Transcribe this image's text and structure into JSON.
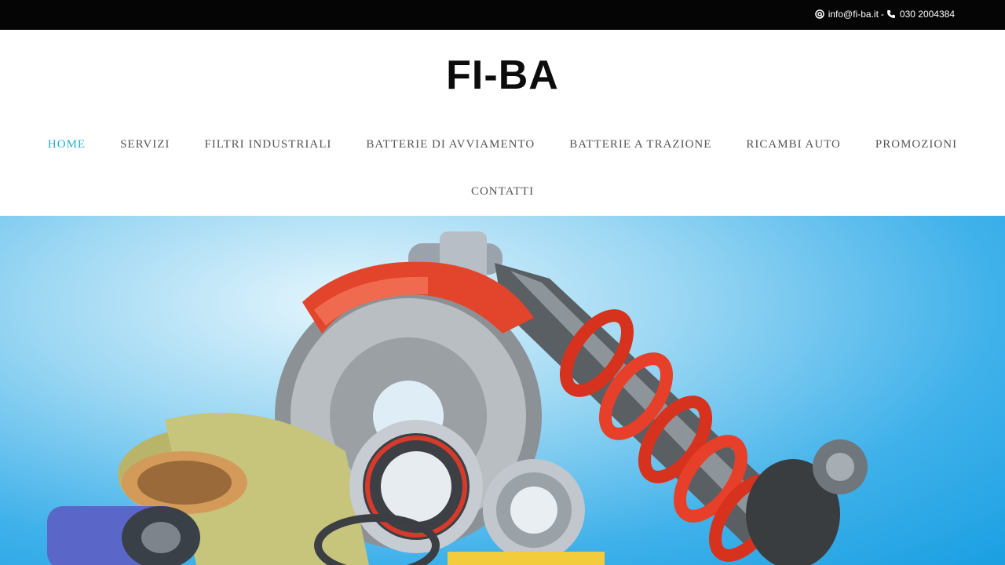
{
  "topbar": {
    "email_icon": "at-icon",
    "email": "info@fi-ba.it",
    "separator": "-",
    "phone_icon": "phone-icon",
    "phone": "030 2004384"
  },
  "header": {
    "logo_text": "FI-BA"
  },
  "nav": {
    "items": [
      {
        "label": "HOME",
        "active": true
      },
      {
        "label": "SERVIZI"
      },
      {
        "label": "FILTRI INDUSTRIALI"
      },
      {
        "label": "BATTERIE DI AVVIAMENTO"
      },
      {
        "label": "BATTERIE A TRAZIONE"
      },
      {
        "label": "RICAMBI AUTO"
      },
      {
        "label": "PROMOZIONI"
      },
      {
        "label": "CONTATTI"
      }
    ],
    "active_color": "#27aecf",
    "text_color": "#555555"
  },
  "hero": {
    "image_description_icon": "auto-parts-image",
    "background_color": "#1a9fe2"
  }
}
